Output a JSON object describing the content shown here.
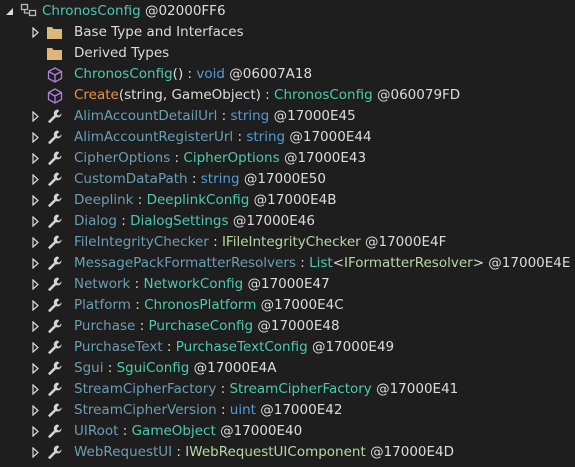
{
  "root": {
    "name": "ChronosConfig",
    "token": "@02000FF6"
  },
  "folders": [
    {
      "label": "Base Type and Interfaces"
    },
    {
      "label": "Derived Types"
    }
  ],
  "methods": [
    {
      "name": "ChronosConfig",
      "params": "()",
      "sep": " : ",
      "ret": "void",
      "token": "@06007A18"
    },
    {
      "name": "Create",
      "params": "(string, GameObject)",
      "sep": " : ",
      "ret": "ChronosConfig",
      "token": "@060079FD"
    }
  ],
  "properties": [
    {
      "name": "AlimAccountDetailUrl",
      "sep": " : ",
      "type": "string",
      "token": "@17000E45"
    },
    {
      "name": "AlimAccountRegisterUrl",
      "sep": " : ",
      "type": "string",
      "token": "@17000E44"
    },
    {
      "name": "CipherOptions",
      "sep": " : ",
      "type": "CipherOptions",
      "token": "@17000E43"
    },
    {
      "name": "CustomDataPath",
      "sep": " : ",
      "type": "string",
      "token": "@17000E50"
    },
    {
      "name": "Deeplink",
      "sep": " : ",
      "type": "DeeplinkConfig",
      "token": "@17000E4B"
    },
    {
      "name": "Dialog",
      "sep": " : ",
      "type": "DialogSettings",
      "token": "@17000E46"
    },
    {
      "name": "FileIntegrityChecker",
      "sep": " : ",
      "type": "IFileIntegrityChecker",
      "token": "@17000E4F"
    },
    {
      "name": "MessagePackFormatterResolvers",
      "sep": " : ",
      "type": "List<IFormatterResolver>",
      "token": "@17000E4E"
    },
    {
      "name": "Network",
      "sep": " : ",
      "type": "NetworkConfig",
      "token": "@17000E47"
    },
    {
      "name": "Platform",
      "sep": " : ",
      "type": "ChronosPlatform",
      "token": "@17000E4C"
    },
    {
      "name": "Purchase",
      "sep": " : ",
      "type": "PurchaseConfig",
      "token": "@17000E48"
    },
    {
      "name": "PurchaseText",
      "sep": " : ",
      "type": "PurchaseTextConfig",
      "token": "@17000E49"
    },
    {
      "name": "Sgui",
      "sep": " : ",
      "type": "SguiConfig",
      "token": "@17000E4A"
    },
    {
      "name": "StreamCipherFactory",
      "sep": " : ",
      "type": "StreamCipherFactory",
      "token": "@17000E41"
    },
    {
      "name": "StreamCipherVersion",
      "sep": " : ",
      "type": "uint",
      "token": "@17000E42"
    },
    {
      "name": "UIRoot",
      "sep": " : ",
      "type": "GameObject",
      "token": "@17000E40"
    },
    {
      "name": "WebRequestUI",
      "sep": " : ",
      "type": "IWebRequestUIComponent",
      "token": "@17000E4D"
    }
  ],
  "colors": {
    "background": "#1e1e1e",
    "type_teal": "#4ec9b0",
    "property_blue": "#6a9fb5",
    "keyword_blue": "#569cd6",
    "method_orange": "#e8914b",
    "interface_green": "#b8d7a3",
    "folder_tan": "#dcb67a",
    "cube_purple": "#b180d7"
  }
}
